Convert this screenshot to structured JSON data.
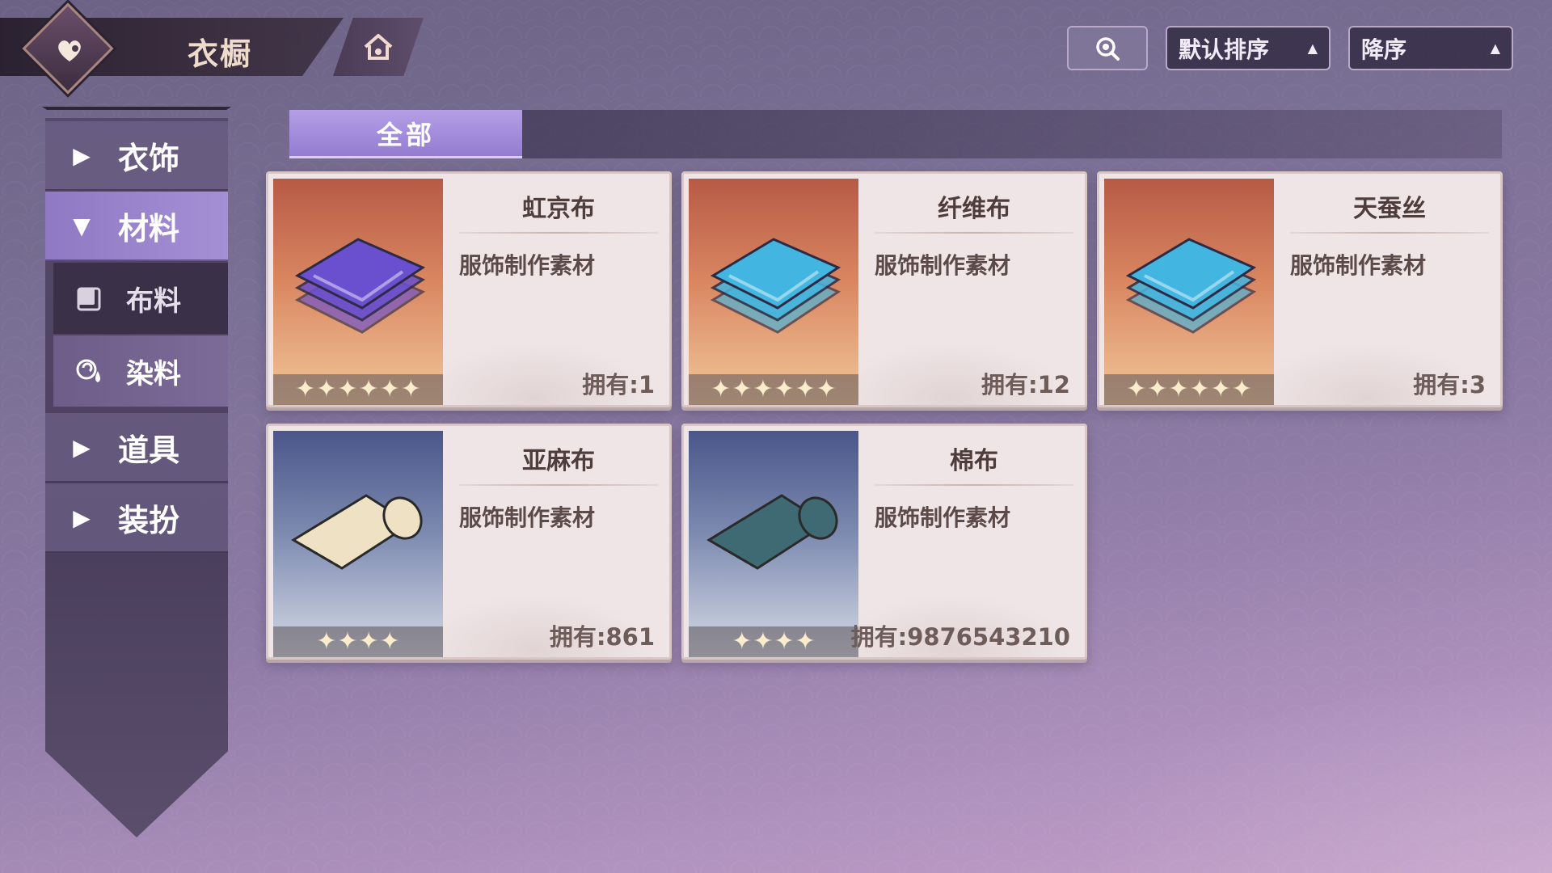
{
  "header": {
    "title": "衣橱",
    "sort_label": "默认排序",
    "order_label": "降序"
  },
  "sidebar": {
    "items": [
      {
        "label": "衣饰",
        "icon": "triangle-right-icon"
      },
      {
        "label": "材料",
        "icon": "triangle-down-icon"
      },
      {
        "label": "布料",
        "icon": "fabric-icon"
      },
      {
        "label": "染料",
        "icon": "dye-icon"
      },
      {
        "label": "道具",
        "icon": "triangle-right-icon"
      },
      {
        "label": "装扮",
        "icon": "triangle-right-icon"
      }
    ]
  },
  "filter": {
    "tab_all": "全部"
  },
  "items": [
    {
      "name": "虹京布",
      "desc": "服饰制作素材",
      "owned": "拥有:1",
      "rarity": 6,
      "thumb": "orange",
      "fabric_color": "#6a4fcf"
    },
    {
      "name": "纤维布",
      "desc": "服饰制作素材",
      "owned": "拥有:12",
      "rarity": 6,
      "thumb": "orange",
      "fabric_color": "#42b6e0"
    },
    {
      "name": "天蚕丝",
      "desc": "服饰制作素材",
      "owned": "拥有:3",
      "rarity": 6,
      "thumb": "orange",
      "fabric_color": "#42b6e0"
    },
    {
      "name": "亚麻布",
      "desc": "服饰制作素材",
      "owned": "拥有:861",
      "rarity": 4,
      "thumb": "blue",
      "fabric_color": "#efe2c4"
    },
    {
      "name": "棉布",
      "desc": "服饰制作素材",
      "owned": "拥有:9876543210",
      "rarity": 4,
      "thumb": "blue",
      "fabric_color": "#3f6a74"
    }
  ],
  "colors": {
    "accent": "#957cd1",
    "star": "#fbeccb",
    "card_bg": "#efe5e6"
  }
}
